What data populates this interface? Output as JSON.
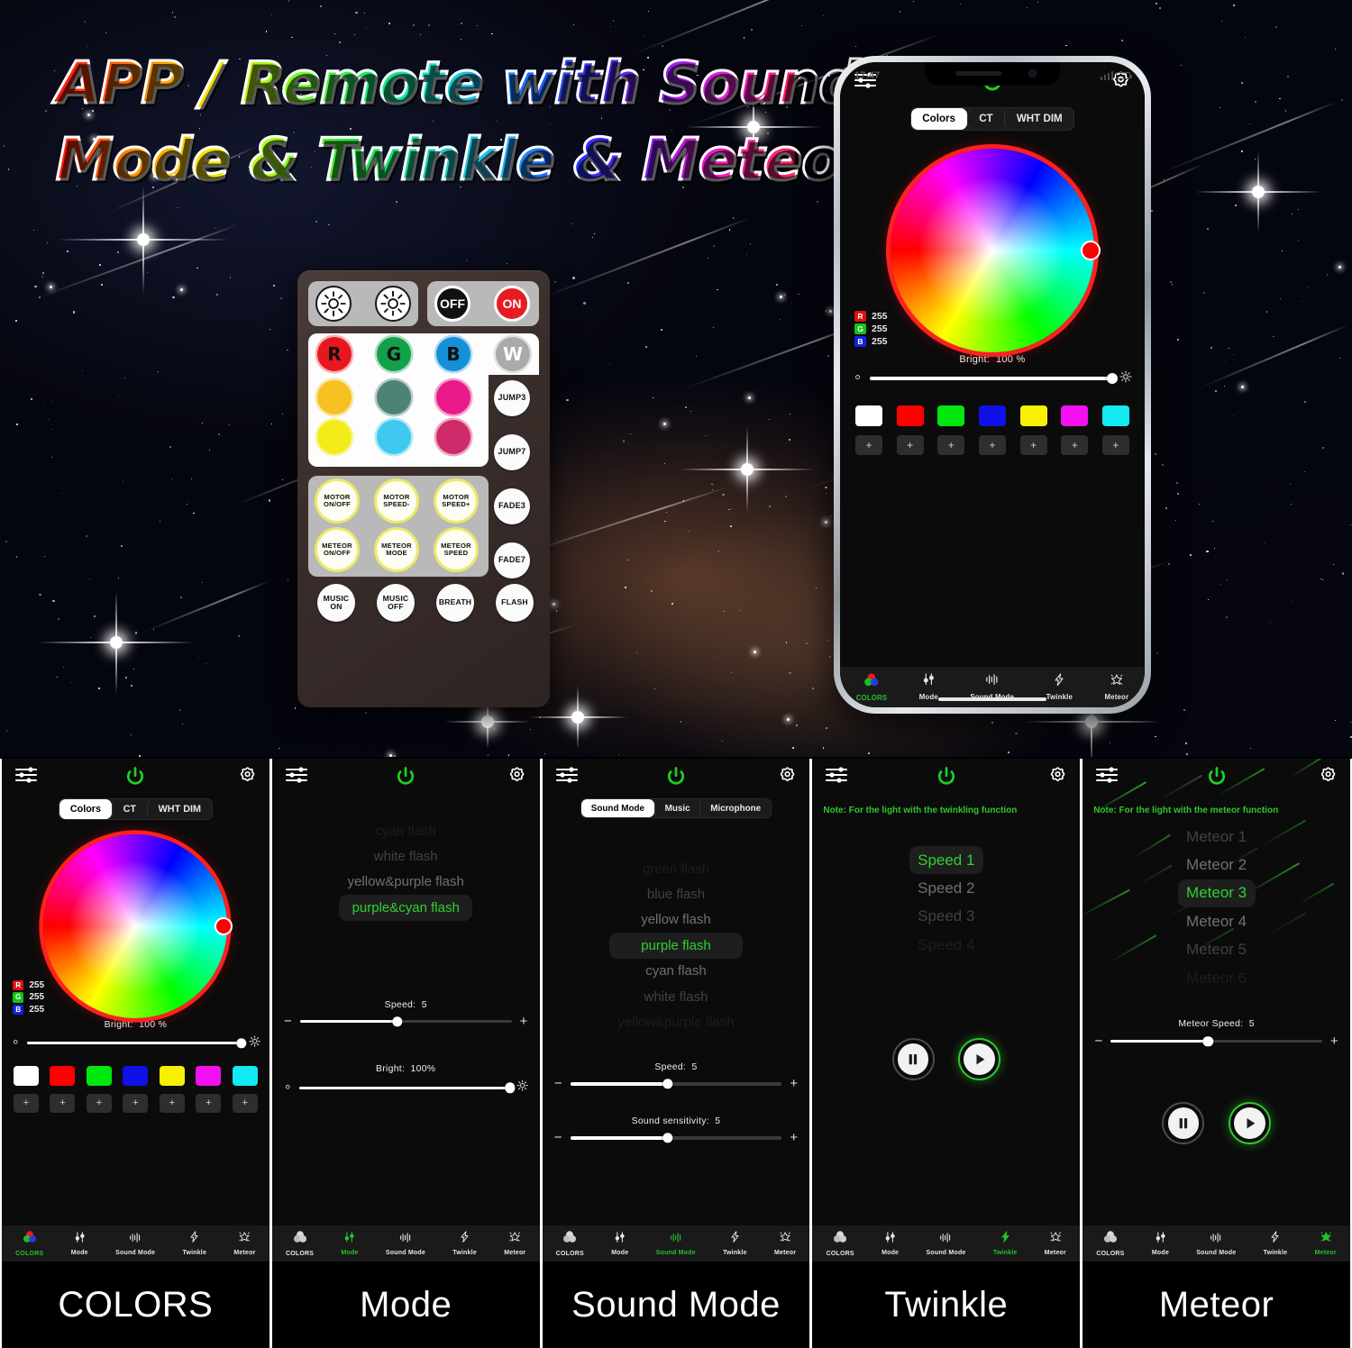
{
  "headline": {
    "line1": "APP / Remote with Sound",
    "line2": "Mode & Twinkle & Meteor"
  },
  "remote": {
    "name": "rgb-ir-remote",
    "row_brightness": [
      {
        "key": "brightness-down",
        "icon": "sun-down-icon",
        "label": ""
      },
      {
        "key": "brightness-up",
        "icon": "sun-up-icon",
        "label": ""
      }
    ],
    "power": [
      {
        "key": "off",
        "label": "OFF"
      },
      {
        "key": "on",
        "label": "ON"
      }
    ],
    "rgbw": [
      {
        "label": "R",
        "color": "#e8171f"
      },
      {
        "label": "G",
        "color": "#13a04a"
      },
      {
        "label": "B",
        "color": "#1590d8"
      },
      {
        "label": "W",
        "color": "#aaaaaa"
      }
    ],
    "color_grid": [
      [
        "#f7c022",
        "#4e8276",
        "#e81a8a"
      ],
      [
        "#f3ec1a",
        "#3fc8f0",
        "#cf2a6a"
      ]
    ],
    "side_buttons": [
      "JUMP3",
      "JUMP7",
      "FADE3",
      "FADE7"
    ],
    "function_buttons": [
      [
        "MOTOR ON/OFF",
        "MOTOR SPEED-",
        "MOTOR SPEED+"
      ],
      [
        "METEOR ON/OFF",
        "METEOR MODE",
        "METEOR SPEED"
      ]
    ],
    "bottom_buttons": [
      "MUSIC ON",
      "MUSIC OFF",
      "BREATH",
      "FLASH"
    ]
  },
  "phone": {
    "status": {
      "time": "17:47"
    },
    "header": {
      "left_icon": "sliders-icon",
      "power_icon": "power-icon",
      "right_icon": "gear-icon"
    },
    "tabs": [
      {
        "label": "Colors",
        "active": true
      },
      {
        "label": "CT",
        "active": false
      },
      {
        "label": "WHT DIM",
        "active": false
      }
    ],
    "rgb": [
      {
        "channel": "R",
        "value": "255",
        "color": "#e01010"
      },
      {
        "channel": "G",
        "value": "255",
        "color": "#11c417"
      },
      {
        "channel": "B",
        "value": "255",
        "color": "#1320e0"
      }
    ],
    "brightness": {
      "label": "Bright:",
      "value": "100 %",
      "percent": 100
    },
    "swatches": [
      "#ffffff",
      "#ff0000",
      "#00e810",
      "#1010e8",
      "#f7f000",
      "#f010f0",
      "#10eaf0"
    ],
    "plus_label": "+",
    "nav": [
      {
        "label": "COLORS",
        "icon": "colors-icon",
        "active": true
      },
      {
        "label": "Mode",
        "icon": "mode-icon",
        "active": false
      },
      {
        "label": "Sound Mode",
        "icon": "sound-mode-icon",
        "active": false
      },
      {
        "label": "Twinkle",
        "icon": "twinkle-icon",
        "active": false
      },
      {
        "label": "Meteor",
        "icon": "meteor-icon",
        "active": false
      }
    ]
  },
  "panels": [
    {
      "id": "colors",
      "caption": "COLORS",
      "tabs": [
        {
          "label": "Colors",
          "active": true
        },
        {
          "label": "CT",
          "active": false
        },
        {
          "label": "WHT DIM",
          "active": false
        }
      ],
      "rgb": [
        {
          "channel": "R",
          "value": "255",
          "color": "#e01010"
        },
        {
          "channel": "G",
          "value": "255",
          "color": "#11c417"
        },
        {
          "channel": "B",
          "value": "255",
          "color": "#1320e0"
        }
      ],
      "brightness": {
        "label": "Bright:",
        "value": "100 %",
        "percent": 100
      },
      "swatches": [
        "#ffffff",
        "#ff0000",
        "#00e810",
        "#1010e8",
        "#f7f000",
        "#f010f0",
        "#10eaf0"
      ],
      "plus_label": "+",
      "nav_active": "COLORS"
    },
    {
      "id": "mode",
      "caption": "Mode",
      "list": [
        {
          "label": "cyan flash",
          "state": "faded"
        },
        {
          "label": "white flash",
          "state": "dim"
        },
        {
          "label": "yellow&purple flash",
          "state": "normal"
        },
        {
          "label": "purple&cyan flash",
          "state": "selected"
        }
      ],
      "sliders": [
        {
          "name": "speed",
          "label": "Speed:",
          "value": "5",
          "percent": 46,
          "minus": "−",
          "plus": "+"
        },
        {
          "name": "bright",
          "label": "Bright:",
          "value": "100%",
          "percent": 100
        }
      ],
      "nav_active": "Mode"
    },
    {
      "id": "sound-mode",
      "caption": "Sound Mode",
      "tabs": [
        {
          "label": "Sound Mode",
          "active": true
        },
        {
          "label": "Music",
          "active": false
        },
        {
          "label": "Microphone",
          "active": false
        }
      ],
      "list": [
        {
          "label": "green flash",
          "state": "faded"
        },
        {
          "label": "blue flash",
          "state": "dim"
        },
        {
          "label": "yellow flash",
          "state": "normal"
        },
        {
          "label": "purple flash",
          "state": "selected"
        },
        {
          "label": "cyan flash",
          "state": "normal"
        },
        {
          "label": "white flash",
          "state": "dim"
        },
        {
          "label": "yellow&purple flash",
          "state": "faded"
        }
      ],
      "sliders": [
        {
          "name": "speed",
          "label": "Speed:",
          "value": "5",
          "percent": 46,
          "minus": "−",
          "plus": "+"
        },
        {
          "name": "sound-sensitivity",
          "label": "Sound sensitivity:",
          "value": "5",
          "percent": 46,
          "minus": "−",
          "plus": "+"
        }
      ],
      "nav_active": "Sound Mode"
    },
    {
      "id": "twinkle",
      "caption": "Twinkle",
      "note": "Note:  For the light with the twinkling function",
      "list": [
        {
          "label": "Speed 1",
          "state": "selected"
        },
        {
          "label": "Speed 2",
          "state": "normal"
        },
        {
          "label": "Speed 3",
          "state": "dim"
        },
        {
          "label": "Speed 4",
          "state": "faded"
        }
      ],
      "transport": [
        {
          "name": "pause",
          "icon": "pause-icon",
          "active": false
        },
        {
          "name": "play",
          "icon": "play-icon",
          "active": true
        }
      ],
      "nav_active": "Twinkle"
    },
    {
      "id": "meteor",
      "caption": "Meteor",
      "note": "Note:  For the light with the meteor function",
      "list": [
        {
          "label": "Meteor 1",
          "state": "dim"
        },
        {
          "label": "Meteor 2",
          "state": "normal"
        },
        {
          "label": "Meteor 3",
          "state": "selected"
        },
        {
          "label": "Meteor 4",
          "state": "normal"
        },
        {
          "label": "Meteor 5",
          "state": "dim"
        },
        {
          "label": "Meteor 6",
          "state": "faded"
        }
      ],
      "slider": {
        "name": "meteor-speed",
        "label": "Meteor Speed:",
        "value": "5",
        "percent": 46,
        "minus": "−",
        "plus": "+"
      },
      "transport": [
        {
          "name": "pause",
          "icon": "pause-icon",
          "active": false
        },
        {
          "name": "play",
          "icon": "play-icon",
          "active": true
        }
      ],
      "nav_active": "Meteor"
    }
  ],
  "colors": {
    "accent_green": "#22c32a",
    "wheel_ring": "#ff2020",
    "panel_bg": "#0b0b0b",
    "nav_bg": "#1a1a1a"
  }
}
